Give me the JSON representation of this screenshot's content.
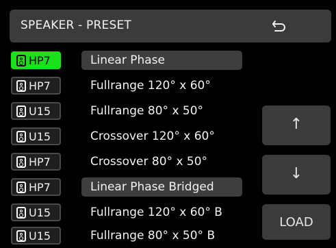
{
  "header": {
    "title": "SPEAKER - PRESET",
    "back_icon": "return-arrow-icon"
  },
  "presets": [
    {
      "model": "HP7",
      "name": "Linear Phase",
      "active": true,
      "highlighted": true
    },
    {
      "model": "HP7",
      "name": "Fullrange 120° x 60°",
      "active": false,
      "highlighted": false
    },
    {
      "model": "U15",
      "name": "Fullrange 80° x 50°",
      "active": false,
      "highlighted": false
    },
    {
      "model": "U15",
      "name": "Crossover 120° x 60°",
      "active": false,
      "highlighted": false
    },
    {
      "model": "HP7",
      "name": "Crossover 80° x 50°",
      "active": false,
      "highlighted": false
    },
    {
      "model": "HP7",
      "name": "Linear Phase  Bridged",
      "active": false,
      "highlighted": true
    },
    {
      "model": "U15",
      "name": "Fullrange 120° x 60° B",
      "active": false,
      "highlighted": false
    },
    {
      "model": "U15",
      "name": "Fullrange 80° x 50° B",
      "active": false,
      "highlighted": false
    }
  ],
  "controls": {
    "up_label": "↑",
    "down_label": "↓",
    "load_label": "LOAD"
  },
  "colors": {
    "active_badge": "#19e019",
    "panel": "#3b3b3b",
    "background": "#000000"
  }
}
